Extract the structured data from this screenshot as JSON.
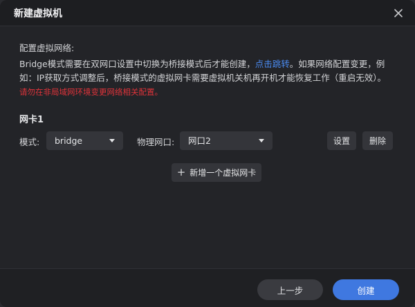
{
  "dialog": {
    "title": "新建虚拟机"
  },
  "section": {
    "label": "配置虚拟网络:"
  },
  "description": {
    "part1": "Bridge模式需要在双网口设置中切换为桥接模式后才能创建，",
    "link": "点击跳转",
    "part2": "。如果网络配置变更，例如：IP获取方式调整后，桥接模式的虚拟网卡需要虚拟机关机再开机才能恢复工作（重启无效）。",
    "warning": "请勿在非局域网环境变更网络相关配置。"
  },
  "nic": {
    "title": "网卡1",
    "mode_label": "模式:",
    "mode_value": "bridge",
    "port_label": "物理网口:",
    "port_value": "网口2",
    "settings_label": "设置",
    "delete_label": "删除"
  },
  "add_nic": {
    "label": "新增一个虚拟网卡"
  },
  "footer": {
    "prev_label": "上一步",
    "create_label": "创建"
  },
  "colors": {
    "link": "#4a8af0",
    "warning": "#e0333a",
    "primary": "#3f78e0"
  }
}
